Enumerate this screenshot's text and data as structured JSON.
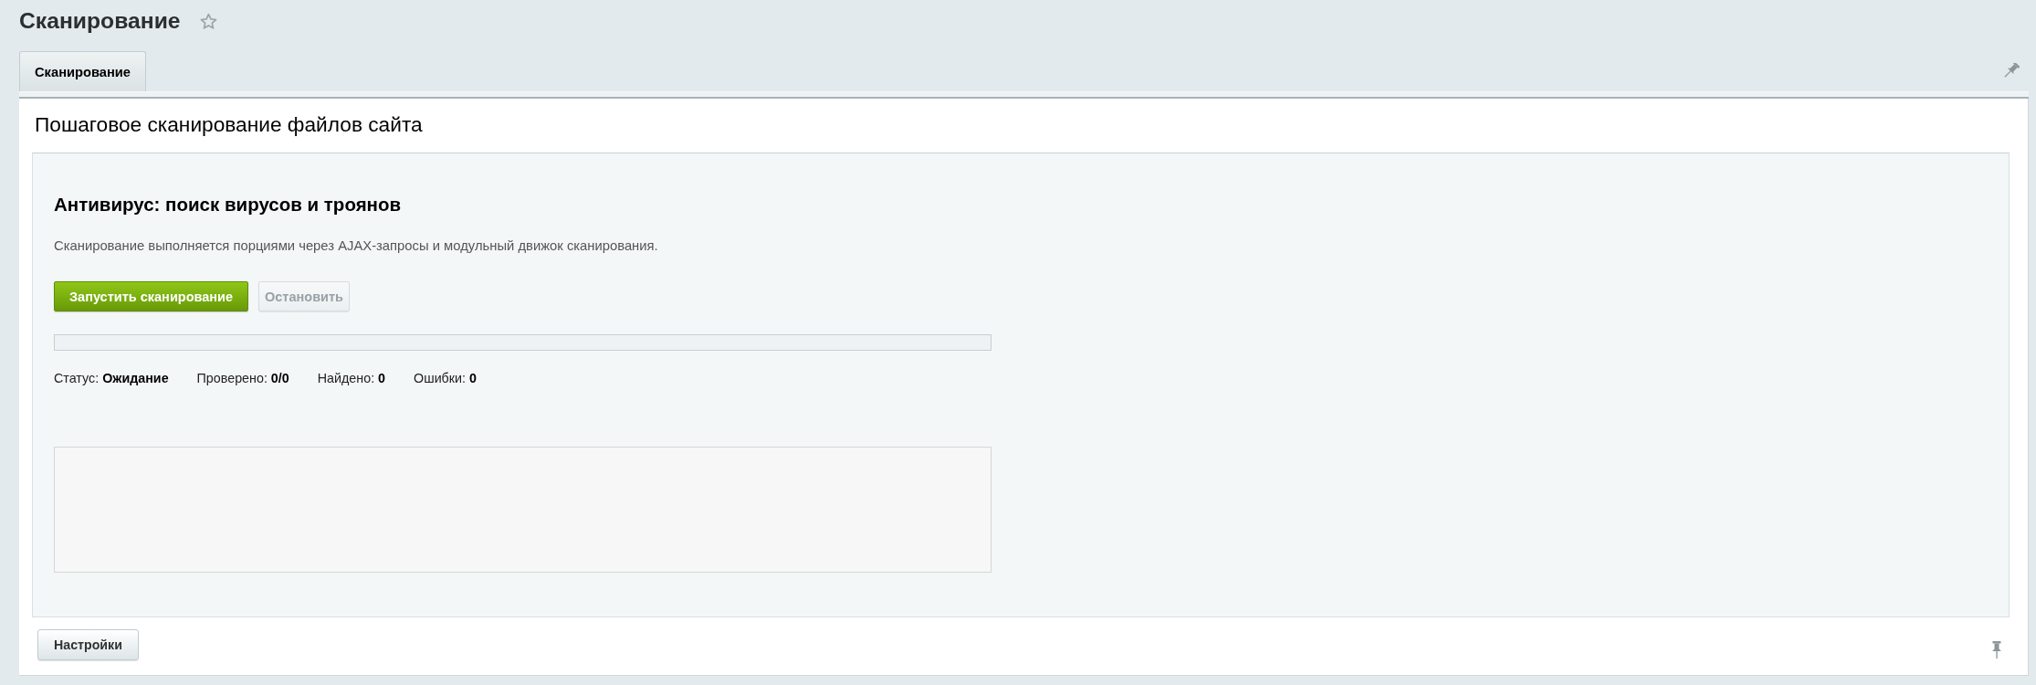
{
  "page": {
    "title": "Сканирование",
    "favorite": false
  },
  "tabs": [
    {
      "label": "Сканирование",
      "selected": true
    }
  ],
  "panel": {
    "heading": "Пошаговое сканирование файлов сайта"
  },
  "scanner": {
    "title": "Антивирус: поиск вирусов и троянов",
    "description": "Сканирование выполняется порциями через AJAX-запросы и модульный движок сканирования.",
    "buttons": [
      {
        "label": "Запустить сканирование",
        "kind": "primary",
        "disabled": false
      },
      {
        "label": "Остановить",
        "kind": "default",
        "disabled": true
      }
    ],
    "progress": {
      "level": 0
    },
    "stats": [
      "Статус: **Ожидание**",
      "Проверено: **0/0**",
      "Найдено: **0**",
      "Ошибки: **0**"
    ]
  },
  "footer": {
    "buttons": [
      {
        "label": "Настройки"
      }
    ]
  }
}
